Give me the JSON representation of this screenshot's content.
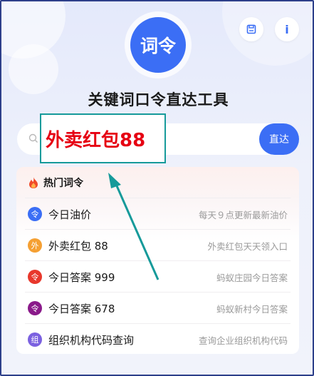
{
  "header": {
    "logo_text": "词令",
    "title": "关键词口令直达工具",
    "save_icon": "save-icon",
    "info_label": "i"
  },
  "search": {
    "value": "外卖红包88",
    "button_label": "直达"
  },
  "hot": {
    "header_label": "热门词令",
    "items": [
      {
        "badge": "令",
        "name": "今日油价",
        "desc": "每天９点更新最新油价",
        "color": "#3b6ef5"
      },
      {
        "badge": "外",
        "name": "外卖红包 88",
        "desc": "外卖红包天天领入口",
        "color": "#f5a033"
      },
      {
        "badge": "令",
        "name": "今日答案 999",
        "desc": "蚂蚁庄园今日答案",
        "color": "#e8382c"
      },
      {
        "badge": "令",
        "name": "今日答案 678",
        "desc": "蚂蚁新村今日答案",
        "color": "#8a1a8a"
      },
      {
        "badge": "组",
        "name": "组织机构代码查询",
        "desc": "查询企业组织机构代码",
        "color": "#7b61e0"
      }
    ]
  },
  "colors": {
    "accent": "#3b6ef5",
    "highlight_border": "#169a9a",
    "highlight_text": "#e60012"
  }
}
